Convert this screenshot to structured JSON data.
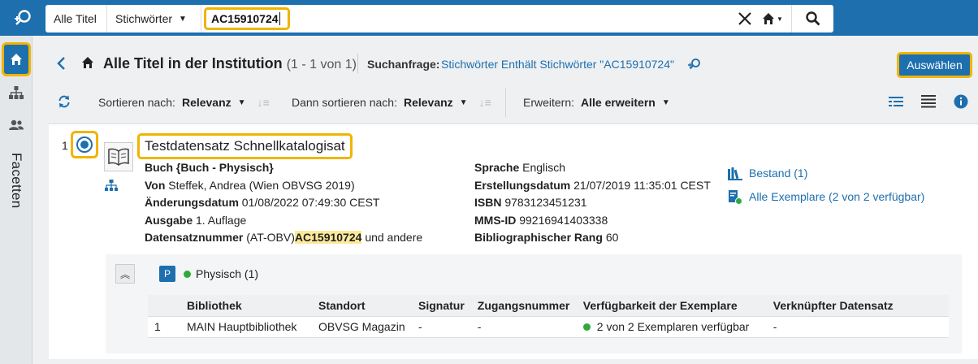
{
  "topbar": {
    "scope": "Alle Titel",
    "field": "Stichwörter",
    "query": "AC15910724"
  },
  "rail": {
    "facets_label": "Facetten"
  },
  "header": {
    "title": "Alle Titel in der Institution",
    "count": "(1 - 1 von 1)",
    "query_label": "Suchanfrage:",
    "query_text": "Stichwörter Enthält Stichwörter \"AC15910724\"",
    "select_button": "Auswählen"
  },
  "sort": {
    "sort_label": "Sortieren nach:",
    "sort_value": "Relevanz",
    "then_label": "Dann sortieren nach:",
    "then_value": "Relevanz",
    "expand_label": "Erweitern:",
    "expand_value": "Alle erweitern"
  },
  "record": {
    "number": "1",
    "title": "Testdatensatz Schnellkatalogisat",
    "left": [
      {
        "label": "Buch {Buch - Physisch}",
        "value": ""
      },
      {
        "label": "Von",
        "value": "Steffek, Andrea (Wien OBVSG 2019)"
      },
      {
        "label": "Änderungsdatum",
        "value": "01/08/2022 07:49:30 CEST"
      },
      {
        "label": "Ausgabe",
        "value": "1. Auflage"
      },
      {
        "label": "Datensatznummer",
        "value_pre": "(AT-OBV)",
        "value_hl": "AC15910724",
        "value_post": "und andere"
      }
    ],
    "right": [
      {
        "label": "Sprache",
        "value": "Englisch"
      },
      {
        "label": "Erstellungsdatum",
        "value": "21/07/2019 11:35:01 CEST"
      },
      {
        "label": "ISBN",
        "value": "9783123451231"
      },
      {
        "label": "MMS-ID",
        "value": "99216941403338"
      },
      {
        "label": "Bibliographischer Rang",
        "value": "60"
      }
    ],
    "links": {
      "holdings": "Bestand (1)",
      "items": "Alle Exemplare (2 von 2 verfügbar)"
    }
  },
  "holdings": {
    "badge": "P",
    "summary": "Physisch (1)",
    "columns": [
      "",
      "Bibliothek",
      "Standort",
      "Signatur",
      "Zugangsnummer",
      "Verfügbarkeit der Exemplare",
      "Verknüpfter Datensatz"
    ],
    "rows": [
      [
        "1",
        "MAIN Hauptbibliothek",
        "OBVSG Magazin",
        "-",
        "-",
        "2 von 2 Exemplaren verfügbar",
        "-"
      ]
    ]
  },
  "colors": {
    "primary": "#1d6fae",
    "highlight": "#f0b400",
    "available": "#2eaa3c"
  },
  "icons": [
    "search-logo-icon",
    "clear-icon",
    "home-icon",
    "search-icon",
    "hierarchy-icon",
    "users-icon",
    "back-icon",
    "refresh-icon",
    "list-view-icon",
    "table-view-icon",
    "info-icon",
    "book-icon",
    "holdings-icon",
    "items-icon",
    "collapse-icon"
  ]
}
